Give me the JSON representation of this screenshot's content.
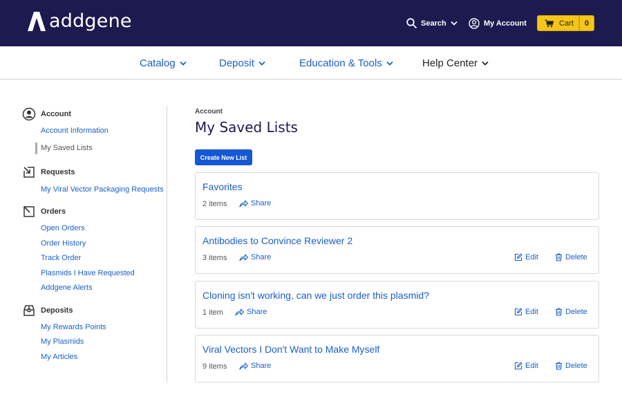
{
  "header": {
    "logo_text": "addgene",
    "search_label": "Search",
    "account_label": "My Account",
    "cart_label": "Cart",
    "cart_count": "0",
    "colors": {
      "bar": "#1d1a4f",
      "cart": "#f5c518"
    }
  },
  "nav": {
    "items": [
      {
        "label": "Catalog"
      },
      {
        "label": "Deposit"
      },
      {
        "label": "Education & Tools"
      },
      {
        "label": "Help Center"
      }
    ]
  },
  "sidebar": {
    "account": {
      "title": "Account",
      "links": [
        "Account Information",
        "My Saved Lists"
      ]
    },
    "requests": {
      "title": "Requests",
      "links": [
        "My Viral Vector Packaging Requests"
      ]
    },
    "orders": {
      "title": "Orders",
      "links": [
        "Open Orders",
        "Order History",
        "Track Order",
        "Plasmids I Have Requested",
        "Addgene Alerts"
      ]
    },
    "deposits": {
      "title": "Deposits",
      "links": [
        "My Rewards Points",
        "My Plasmids",
        "My Articles"
      ]
    }
  },
  "main": {
    "breadcrumb": "Account",
    "title": "My Saved Lists",
    "create_label": "Create New List",
    "share_label": "Share",
    "edit_label": "Edit",
    "delete_label": "Delete",
    "lists": [
      {
        "name": "Favorites",
        "count": "2 items"
      },
      {
        "name": "Antibodies to Convince Reviewer 2",
        "count": "3 items"
      },
      {
        "name": "Cloning isn't working, can we just order this plasmid?",
        "count": "1 item"
      },
      {
        "name": "Viral Vectors I Don't Want to Make Myself",
        "count": "9 items"
      }
    ],
    "accent": "#1657d4"
  }
}
